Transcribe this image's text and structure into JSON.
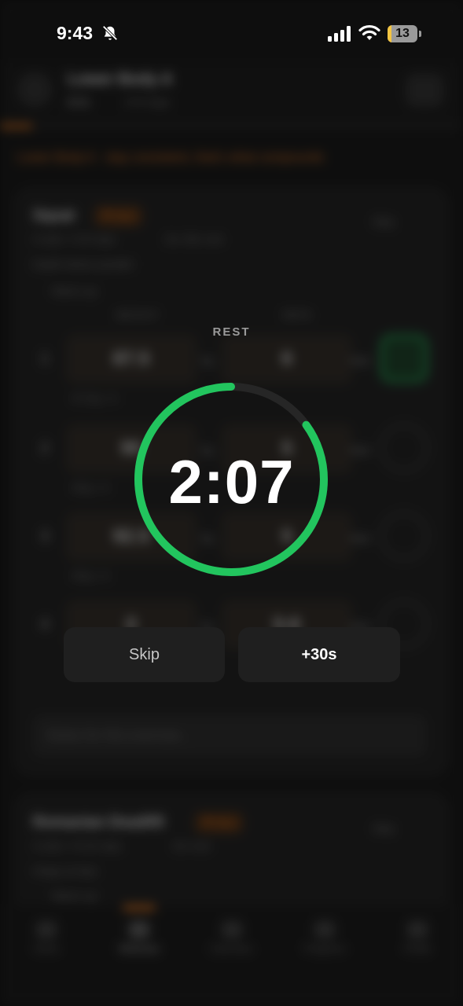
{
  "status_bar": {
    "time": "9:43",
    "battery_level": "13",
    "battery_fraction": 0.13,
    "icons": [
      "bell-slash-icon",
      "signal-icon",
      "wifi-icon",
      "battery-icon"
    ]
  },
  "background": {
    "header": {
      "title": "Lower Body A",
      "elapsed": "8:01",
      "subtitle": "174 reps"
    },
    "workout_progress": 0.07,
    "hint": "Lower Body A · stay consistent, that's what compounds",
    "exercises": [
      {
        "name": "Squat",
        "badge": "⚑ New",
        "detail_left": "4 sets × 6-8 reps",
        "detail_right": "2m 30s rest",
        "note": "Depth below parallel",
        "warmup": "Warm-up",
        "skip": "Skip",
        "columns": [
          "WEIGHT",
          "REPS"
        ],
        "sets": [
          {
            "num": "1",
            "weight": "87.5",
            "unit": "kg",
            "reps": "6",
            "reps_unit": "reps",
            "done": true,
            "sub": "87.5kg × 6"
          },
          {
            "num": "2",
            "weight": "90",
            "unit": "kg",
            "reps": "5",
            "reps_unit": "reps",
            "done": false,
            "sub": "90kg × 6"
          },
          {
            "num": "3",
            "weight": "92.5",
            "unit": "kg",
            "reps": "5",
            "reps_unit": "reps",
            "done": false,
            "sub": "90kg × 6"
          },
          {
            "num": "4",
            "weight": "0",
            "unit": "kg",
            "reps": "5-6",
            "reps_unit": "reps",
            "done": false,
            "sub": ""
          }
        ],
        "notes_placeholder": "Notes for this exercise..."
      },
      {
        "name": "Romanian Deadlift",
        "badge": "⚑ New",
        "detail_left": "3 sets × 8-10 reps",
        "detail_right": "2m rest",
        "note": "Hinge at hips",
        "warmup": "Warm-up",
        "skip": "Skip"
      }
    ],
    "tabs": [
      "Home",
      "Workouts",
      "Exercises",
      "Programs",
      "Profile"
    ],
    "active_tab": "Workouts"
  },
  "rest_timer": {
    "label": "REST",
    "time": "2:07",
    "progress_fraction": 0.85,
    "ring_color": "#22c55e",
    "track_color": "#262626",
    "skip_label": "Skip",
    "add_label": "+30s"
  },
  "colors": {
    "accent_orange": "#f07a1a",
    "success_green": "#22c55e"
  }
}
